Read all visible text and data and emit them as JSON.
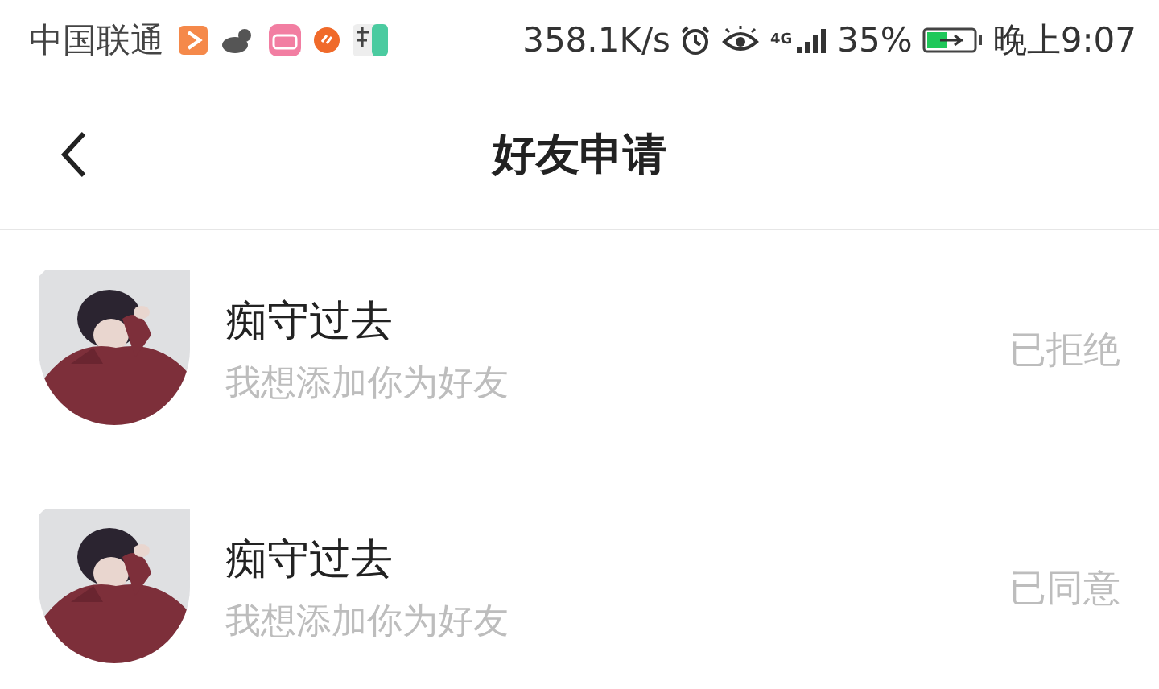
{
  "status_bar": {
    "carrier": "中国联通",
    "network_speed": "358.1K/s",
    "network_type": "4G",
    "battery_percent": "35%",
    "time": "晚上9:07"
  },
  "header": {
    "title": "好友申请"
  },
  "requests": [
    {
      "name": "痴守过去",
      "message": "我想添加你为好友",
      "status": "已拒绝"
    },
    {
      "name": "痴守过去",
      "message": "我想添加你为好友",
      "status": "已同意"
    }
  ]
}
